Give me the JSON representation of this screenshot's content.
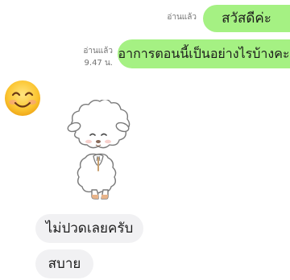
{
  "messages": {
    "out": [
      {
        "text": "สวัสดีค่ะ",
        "read_label": "อ่านแล้ว",
        "time": ""
      },
      {
        "text": "อาการตอนนี้เป็นอย่างไรบ้างคะ",
        "read_label": "อ่านแล้ว",
        "time": "9.47 น."
      }
    ],
    "in": [
      {
        "text": "ไม่ปวดเลยครับ"
      },
      {
        "text": "สบาย"
      }
    ]
  },
  "emoji": {
    "icon": "smiling-face-emoji"
  },
  "sticker": {
    "icon": "white-sheep-bowing-sticker"
  },
  "colors": {
    "outgoing_bubble": "#a5f183",
    "incoming_bubble": "#f1f1f3",
    "meta_text": "#707070"
  }
}
